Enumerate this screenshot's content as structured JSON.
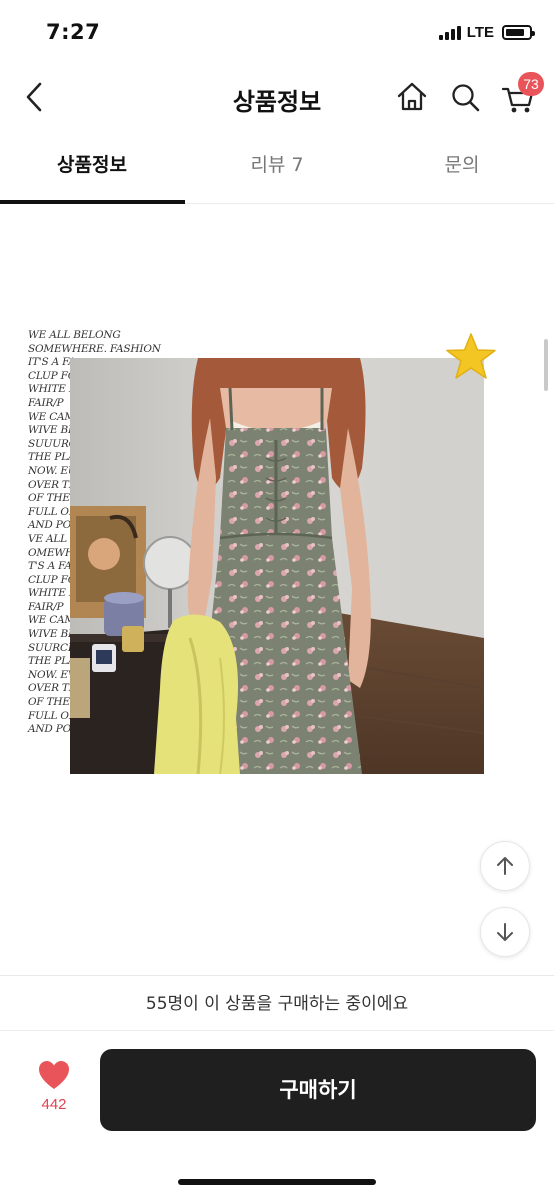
{
  "status_bar": {
    "time": "7:27",
    "network": "LTE",
    "battery_icon": "battery-icon",
    "signal_icon": "signal-bars-icon"
  },
  "header": {
    "title": "상품정보",
    "back_icon": "chevron-left-icon",
    "home_icon": "home-icon",
    "search_icon": "search-icon",
    "cart_icon": "cart-icon",
    "cart_badge": "73"
  },
  "tabs": [
    {
      "label": "상품정보",
      "active": true
    },
    {
      "label": "리뷰 7",
      "active": false
    },
    {
      "label": "문의",
      "active": false
    }
  ],
  "content": {
    "poem_lines": [
      "WE ALL BELONG",
      "SOMEWHERE. FASHION",
      "IT'S A FA",
      "CLUP FO",
      "WHITE F",
      "FAIR/P",
      "WE CAM",
      "WIVE BR",
      "SUUURC",
      "THE PLA",
      "NOW. EU",
      "OVER TH",
      "OF THE",
      "FULL OF",
      "AND POE",
      "VE ALL B",
      "OMEWH",
      "T'S A FAS",
      "CLUP FOR",
      "WHITE FU",
      "FAIR/P",
      "WE CAME",
      "WIVE BRO",
      "SUURCIA",
      "THE PLAC",
      "NOW. EVE",
      "OVER THE",
      "OF THE EN",
      "FULL OF E",
      "AND POE"
    ],
    "star_icon": "star-sticker-icon",
    "product_image": "product-photo",
    "scroll_up_icon": "arrow-up-icon",
    "scroll_down_icon": "arrow-down-icon"
  },
  "bottom": {
    "buying_notice": "55명이 이 상품을 구매하는 중이에요",
    "like_icon": "heart-icon",
    "like_count": "442",
    "buy_label": "구매하기"
  },
  "colors": {
    "accent_red": "#e9545b",
    "like_red": "#e0444e",
    "buy_button": "#1f1f1f"
  }
}
